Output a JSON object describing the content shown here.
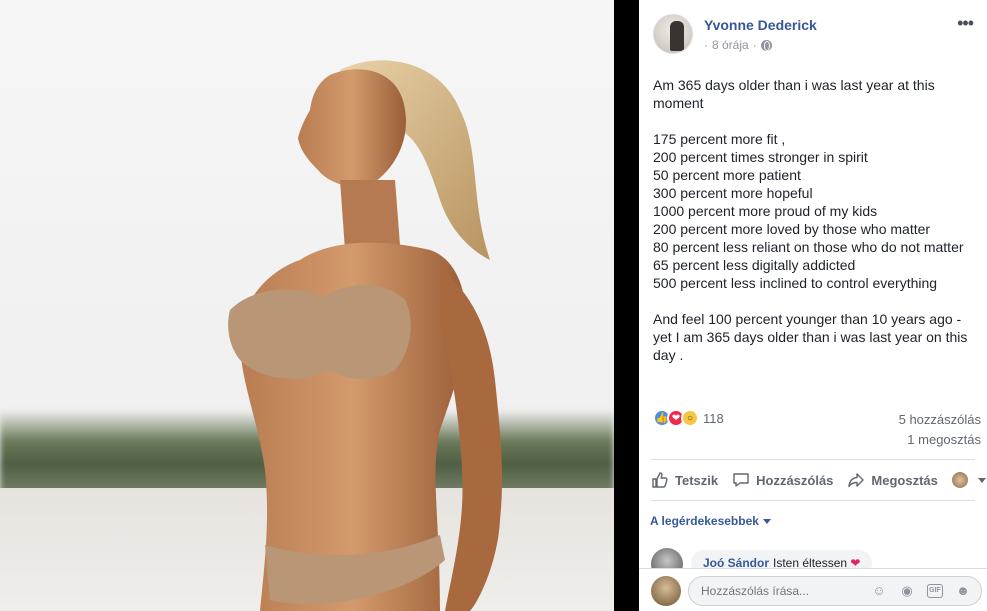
{
  "post": {
    "author": "Yvonne Dederick",
    "time": "8 órája",
    "separator": "·",
    "text": "Am 365 days older than i was last year at this moment\n\n175 percent more fit ,\n200 percent times stronger in spirit\n50 percent more patient\n300 percent more hopeful\n1000 percent more proud of my kids\n200 percent more loved by those who matter\n80 percent less reliant on those who do not matter\n65 percent less digitally addicted\n500 percent less inclined to control everything\n\nAnd feel 100 percent younger than 10 years ago - yet I am 365 days older than i was last year on this day ."
  },
  "stats": {
    "reaction_count": "118",
    "comments": "5 hozzászólás",
    "shares": "1 megosztás",
    "reaction_icons": [
      "like-icon",
      "love-icon",
      "wow-icon"
    ]
  },
  "actions": {
    "like": "Tetszik",
    "comment": "Hozzászólás",
    "share": "Megosztás"
  },
  "sort": {
    "label": "A legérdekesebbek"
  },
  "comment": {
    "name": "Joó Sándor",
    "text": "Isten éltessen"
  },
  "reply": {
    "placeholder": "Hozzászólás írása..."
  },
  "colors": {
    "link": "#365899",
    "secondary": "#90949c",
    "like": "#4a90e2",
    "love": "#f0284a",
    "wow": "#f7c744"
  }
}
